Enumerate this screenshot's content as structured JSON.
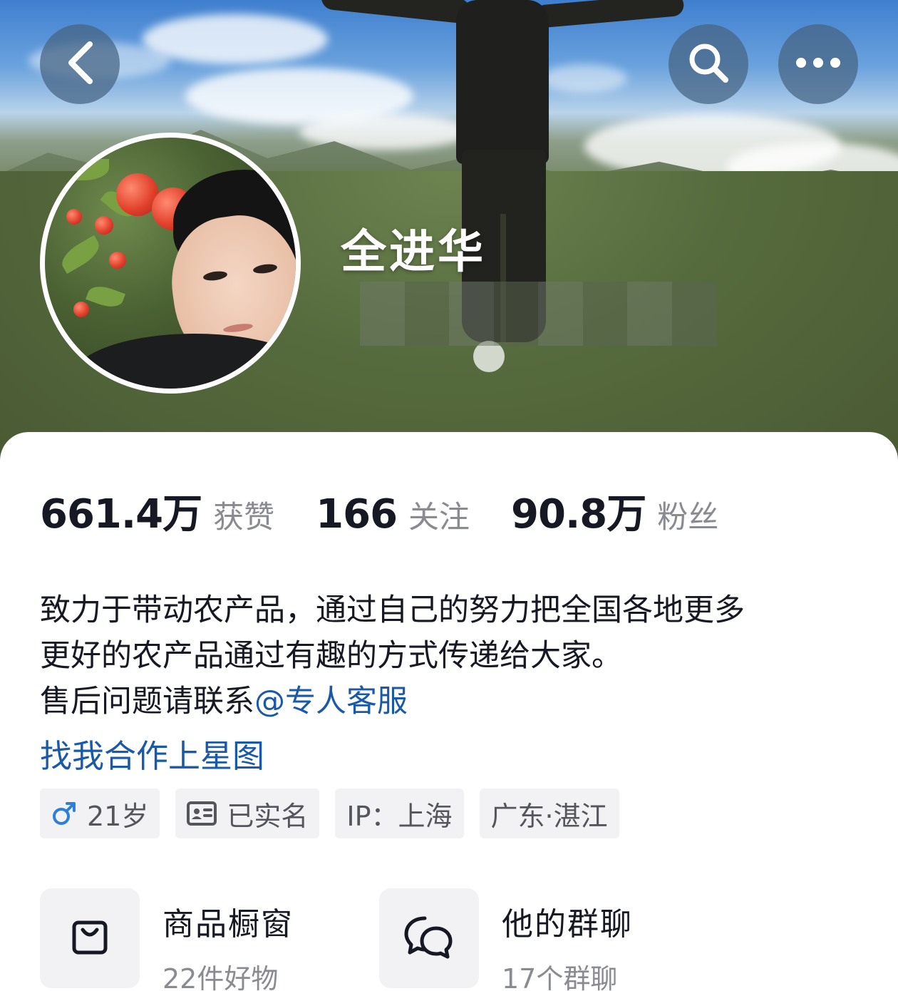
{
  "profile": {
    "nickname": "全进华"
  },
  "header": {
    "back_icon": "chevron-left-icon",
    "search_icon": "search-icon",
    "more_icon": "more-horizontal-icon"
  },
  "stats": [
    {
      "value": "661.4万",
      "label": "获赞"
    },
    {
      "value": "166",
      "label": "关注"
    },
    {
      "value": "90.8万",
      "label": "粉丝"
    }
  ],
  "bio": {
    "line1": "致力于带动农产品，通过自己的努力把全国各地更多",
    "line2": "更好的农产品通过有趣的方式传递给大家。",
    "line3_prefix": "售后问题请联系",
    "line3_mention": "@专人客服"
  },
  "star_link": "找我合作上星图",
  "tags": {
    "age": "21岁",
    "verified": "已实名",
    "ip": "IP：上海",
    "location": "广东·湛江"
  },
  "entries": [
    {
      "title": "商品橱窗",
      "sub": "22件好物",
      "icon": "shopping-bag-icon"
    },
    {
      "title": "他的群聊",
      "sub": "17个群聊",
      "icon": "chat-bubbles-icon"
    }
  ],
  "colors": {
    "link": "#1a59a8",
    "text": "#161823",
    "secondary": "#8a8b91",
    "tag_bg": "#f2f2f4",
    "male": "#2f7fd8"
  }
}
